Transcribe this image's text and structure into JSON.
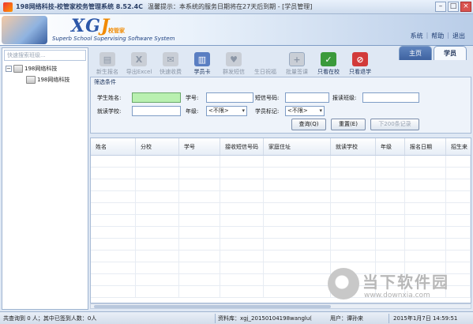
{
  "window": {
    "title": "198网络科技-校管家校务管理系统 8.52.4C",
    "notice": "温馨提示：本系统的服务日期将在27天后到期 - [学员管理]",
    "minimize": "–",
    "maximize": "□",
    "close": "×"
  },
  "banner": {
    "brand_main": "XG",
    "brand_accent": "J",
    "badge": "校管家",
    "slogan": "Superb School Supervising Software System"
  },
  "topmenu": {
    "system": "系统",
    "help": "帮助",
    "exit": "退出",
    "sep": "|"
  },
  "tabs": {
    "home": "主页",
    "students": "学员"
  },
  "left": {
    "search_placeholder": "快速搜索班级...",
    "tree_root": "198网络科技",
    "tree_child": "198网络科技",
    "toggle": "−"
  },
  "toolbar": {
    "new_signup": "新生报名",
    "export_excel": "导出Excel",
    "quick_fee": "快速收费",
    "student_card": "学员卡",
    "group_sms": "群发短信",
    "birthday": "生日祝福",
    "batch_sign": "批量签课",
    "view_enrolled": "只看在校",
    "view_dropped": "只看退学",
    "excel_glyph": "X"
  },
  "filter": {
    "legend": "筛选条件",
    "student_name_label": "学生姓名:",
    "student_no_label": "学号:",
    "sms_no_label": "短信号码:",
    "signup_class_label": "报读班级:",
    "school_label": "就读学校:",
    "grade_label": "年级:",
    "grade_value": "<不限>",
    "student_tag_label": "学员标记:",
    "student_tag_value": "<不限>",
    "query_button": "查询(Q)",
    "reset_button": "重置(E)",
    "next200_button": "下200条记录"
  },
  "grid": {
    "columns": [
      "姓名",
      "分校",
      "学号",
      "接收短信号码",
      "家庭住址",
      "就读学校",
      "年级",
      "报名日期",
      "招生来"
    ]
  },
  "watermark": {
    "text": "当下软件园",
    "url": "www.downxia.com"
  },
  "status": {
    "counts": "共查询到 0 人；其中已签到人数：0人",
    "database": "资料库：xgj_20150104198wanglu(",
    "user": "用户：谭孙来",
    "datetime": "2015年1月7日    14:59:51"
  }
}
